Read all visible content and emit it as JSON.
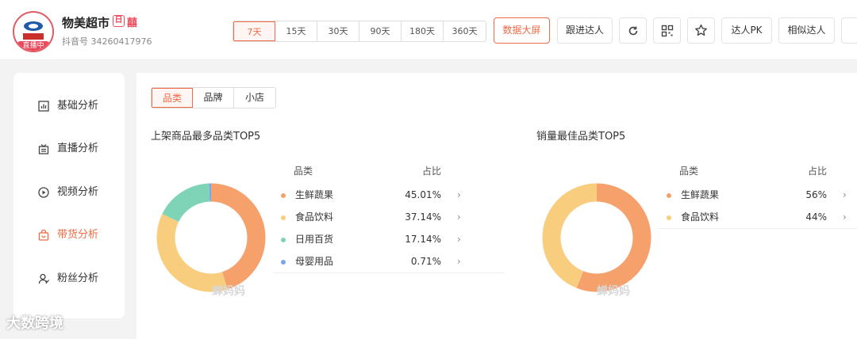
{
  "header": {
    "shop_name": "物美超市",
    "tag_glyph": "日",
    "tag_text": "囍",
    "live_badge": "直播中",
    "account_id": "抖音号 34260417976"
  },
  "range_tabs": [
    {
      "label": "7天",
      "active": true
    },
    {
      "label": "15天",
      "active": false
    },
    {
      "label": "30天",
      "active": false
    },
    {
      "label": "90天",
      "active": false
    },
    {
      "label": "180天",
      "active": false
    },
    {
      "label": "360天",
      "active": false
    }
  ],
  "toolbar": {
    "big_screen": "数据大屏",
    "follow": "跟进达人",
    "pk": "达人PK",
    "similar": "相似达人"
  },
  "sidebar": {
    "items": [
      {
        "label": "基础分析",
        "icon": "bar-chart-icon",
        "active": false
      },
      {
        "label": "直播分析",
        "icon": "live-icon",
        "active": false
      },
      {
        "label": "视频分析",
        "icon": "play-icon",
        "active": false
      },
      {
        "label": "带货分析",
        "icon": "bag-icon",
        "active": true
      },
      {
        "label": "粉丝分析",
        "icon": "user-icon",
        "active": false
      }
    ]
  },
  "tabs": [
    {
      "label": "品类",
      "active": true
    },
    {
      "label": "品牌",
      "active": false
    },
    {
      "label": "小店",
      "active": false
    }
  ],
  "panels": [
    {
      "title": "上架商品最多品类TOP5",
      "col_category": "品类",
      "col_share": "占比",
      "watermark": "蝉妈妈",
      "chart_data": {
        "type": "pie",
        "categories": [
          "生鲜蔬果",
          "食品饮料",
          "日用百货",
          "母婴用品"
        ],
        "values": [
          45.01,
          37.14,
          17.14,
          0.71
        ],
        "labels": [
          "45.01%",
          "37.14%",
          "17.14%",
          "0.71%"
        ],
        "colors": [
          "#f6a06c",
          "#f8cd7e",
          "#7fd3b7",
          "#7aa8e6"
        ]
      }
    },
    {
      "title": "销量最佳品类TOP5",
      "col_category": "品类",
      "col_share": "占比",
      "watermark": "蝉妈妈",
      "chart_data": {
        "type": "pie",
        "categories": [
          "生鲜蔬果",
          "食品饮料"
        ],
        "values": [
          56,
          44
        ],
        "labels": [
          "56%",
          "44%"
        ],
        "colors": [
          "#f6a06c",
          "#f8cd7e"
        ]
      }
    }
  ],
  "footer_watermark": "大数跨境"
}
